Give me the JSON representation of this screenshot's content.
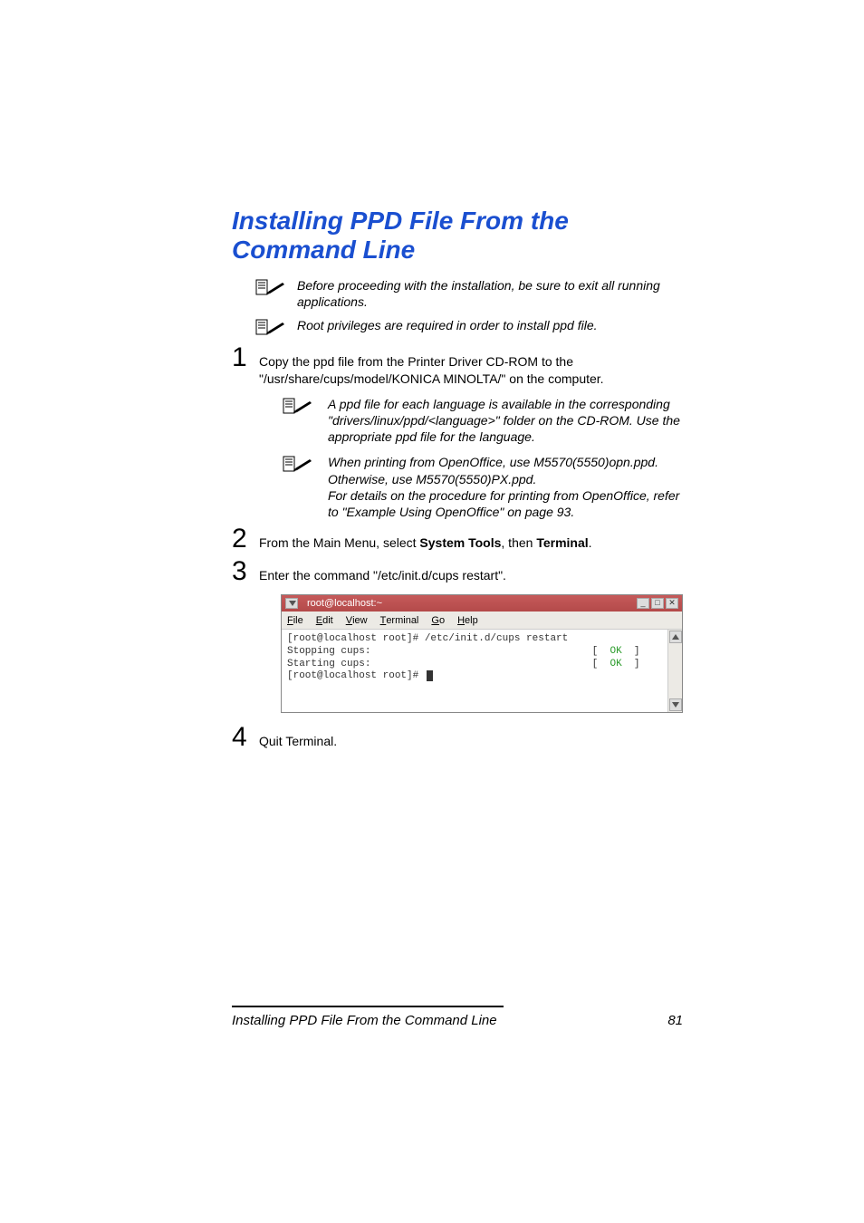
{
  "heading": "Installing PPD File From the Command Line",
  "notes": {
    "top1": "Before proceeding with the installation, be sure to exit all running applications.",
    "top2": "Root privileges are required in order to install ppd file."
  },
  "steps": {
    "s1_num": "1",
    "s1_text": "Copy the ppd file from the Printer Driver CD-ROM to the \"/usr/share/cups/model/KONICA MINOLTA/\" on the computer.",
    "s1_note1": "A ppd file for each language is available in the corresponding \"drivers/linux/ppd/<language>\" folder on the CD-ROM. Use the appropriate ppd file for the language.",
    "s1_note2": "When printing from OpenOffice, use M5570(5550)opn.ppd. Otherwise, use M5570(5550)PX.ppd.\nFor details on the procedure for printing from OpenOffice, refer to \"Example Using OpenOffice\" on page 93.",
    "s2_num": "2",
    "s2_text_pre": "From the Main Menu, select ",
    "s2_bold1": "System Tools",
    "s2_text_mid": ", then ",
    "s2_bold2": "Terminal",
    "s2_text_post": ".",
    "s3_num": "3",
    "s3_text": "Enter the command \"/etc/init.d/cups restart\".",
    "s4_num": "4",
    "s4_text": "Quit Terminal."
  },
  "terminal": {
    "title": "root@localhost:~",
    "menu": {
      "file": "File",
      "edit": "Edit",
      "view": "View",
      "terminal": "Terminal",
      "go": "Go",
      "help": "Help"
    },
    "line1": "[root@localhost root]# /etc/init.d/cups restart",
    "line2_l": "Stopping cups:",
    "line2_r_open": "[  ",
    "line2_ok": "OK",
    "line2_r_close": "  ]",
    "line3_l": "Starting cups:",
    "line3_r_open": "[  ",
    "line3_ok": "OK",
    "line3_r_close": "  ]",
    "line4": "[root@localhost root]# "
  },
  "footer": {
    "title": "Installing PPD File From the Command Line",
    "page": "81"
  }
}
